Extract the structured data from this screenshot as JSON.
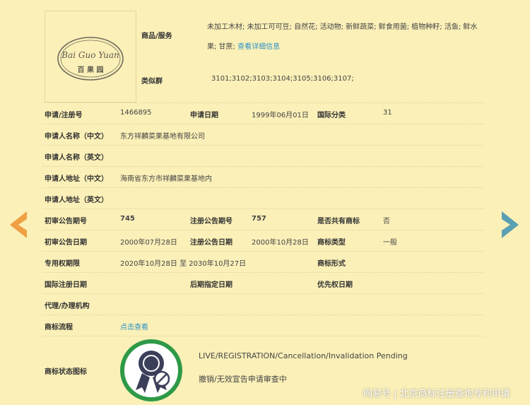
{
  "logo": {
    "wordmark_latin": "Bai Guo Yuan",
    "wordmark_cn": "百 果 园"
  },
  "goods": {
    "label": "商品/服务",
    "text": "未加工木材; 未加工可可豆; 自然花; 活动物; 新鲜蔬菜; 鲜食用菌; 植物种籽; 活鱼; 鲜水果; 甘蔗;",
    "more_link": "查看详细信息"
  },
  "similar_group": {
    "label": "类似群",
    "value": "3101;3102;3103;3104;3105;3106;3107;"
  },
  "rows": {
    "app_no_label": "申请/注册号",
    "app_no": "1466895",
    "app_date_label": "申请日期",
    "app_date": "1999年06月01日",
    "intl_class_label": "国际分类",
    "intl_class": "31",
    "applicant_cn_label": "申请人名称（中文）",
    "applicant_cn": "东方祥麟菜果基地有限公司",
    "applicant_en_label": "申请人名称（英文）",
    "address_cn_label": "申请人地址（中文）",
    "address_cn": "海南省东方市祥麟菜果基地内",
    "address_en_label": "申请人地址（英文）",
    "prelim_issue_label": "初审公告期号",
    "prelim_issue": "745",
    "reg_issue_label": "注册公告期号",
    "reg_issue": "757",
    "shared_label": "是否共有商标",
    "shared": "否",
    "prelim_date_label": "初审公告日期",
    "prelim_date": "2000年07月28日",
    "reg_date_label": "注册公告日期",
    "reg_date": "2000年10月28日",
    "tm_type_label": "商标类型",
    "tm_type": "一般",
    "exclusive_label": "专用权期限",
    "exclusive": "2020年10月28日 至 2030年10月27日",
    "tm_form_label": "商标形式",
    "intl_reg_date_label": "国际注册日期",
    "later_date_label": "后期指定日期",
    "priority_date_label": "优先权日期",
    "agent_label": "代理/办理机构",
    "process_label": "商标流程",
    "process_link": "点击查看",
    "status_icon_label": "商标状态图标",
    "status_en": "LIVE/REGISTRATION/Cancellation/Invalidation Pending",
    "status_cn": "撤销/无效宣告申请审查中"
  },
  "colors": {
    "background": "#fbf0b8",
    "link": "#2a94c8",
    "prev_arrow": "#f0a044",
    "next_arrow": "#5aa0b4",
    "status_ring": "#2e9a47",
    "status_badge": "#3c3f5a"
  },
  "icons": {
    "prev": "chevron-left-icon",
    "next": "chevron-right-icon",
    "status": "award-ribbon-icon"
  },
  "watermark": "网易号 | 北京商标注册查询专利申请"
}
